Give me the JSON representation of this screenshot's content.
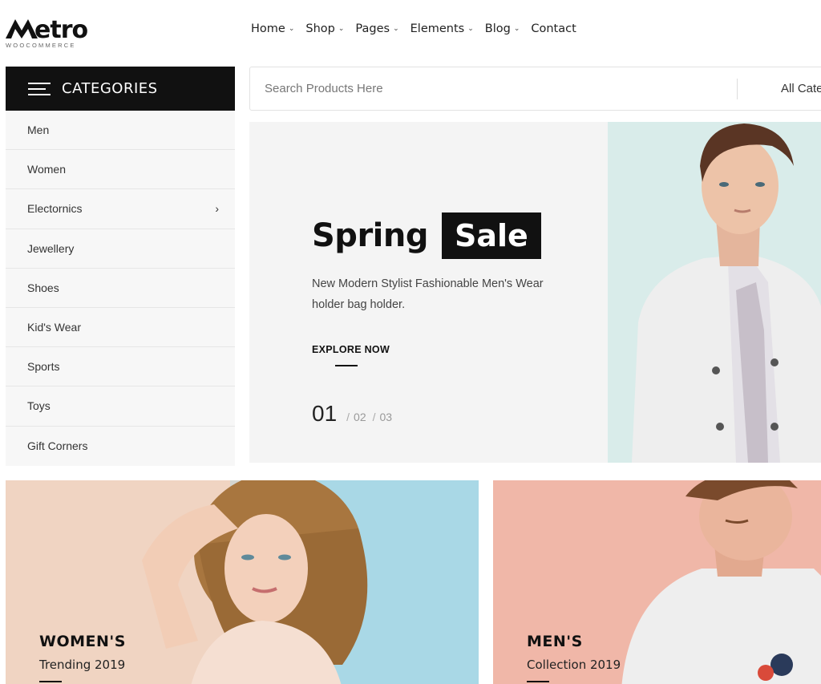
{
  "brand": {
    "name": "etro",
    "sub": "WOOCOMMERCE"
  },
  "nav": [
    {
      "label": "Home",
      "has_dropdown": true
    },
    {
      "label": "Shop",
      "has_dropdown": true
    },
    {
      "label": "Pages",
      "has_dropdown": true
    },
    {
      "label": "Elements",
      "has_dropdown": true
    },
    {
      "label": "Blog",
      "has_dropdown": true
    },
    {
      "label": "Contact",
      "has_dropdown": false
    }
  ],
  "categories": {
    "title": "CATEGORIES",
    "items": [
      {
        "label": "Men"
      },
      {
        "label": "Women"
      },
      {
        "label": "Electornics",
        "has_submenu": true
      },
      {
        "label": "Jewellery"
      },
      {
        "label": "Shoes"
      },
      {
        "label": "Kid's Wear"
      },
      {
        "label": "Sports"
      },
      {
        "label": "Toys"
      },
      {
        "label": "Gift Corners"
      }
    ]
  },
  "search": {
    "placeholder": "Search Products Here",
    "category_label": "All Categories"
  },
  "hero": {
    "title_word1": "Spring",
    "title_word2": "Sale",
    "description": "New Modern Stylist Fashionable Men's Wear holder bag holder.",
    "cta": "EXPLORE NOW",
    "pager": {
      "current": "01",
      "pages": [
        "02",
        "03"
      ],
      "separator": "/"
    }
  },
  "promos": [
    {
      "heading": "WOMEN'S",
      "sub": "Trending 2019"
    },
    {
      "heading": "MEN'S",
      "sub": "Collection 2019"
    }
  ],
  "colors": {
    "dark": "#111111",
    "hero_bg": "#f4f4f4",
    "hero_photo_bg": "#d9ecea",
    "women_bg": "#a9d8e6",
    "men_bg": "#f0b7a8"
  }
}
